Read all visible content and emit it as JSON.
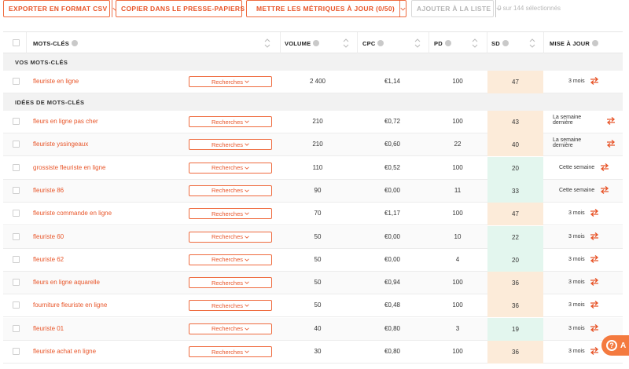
{
  "toolbar": {
    "export_label": "EXPORTER EN FORMAT CSV",
    "copy_label": "COPIER DANS LE PRESSE-PAPIERS",
    "update_label": "METTRE LES MÉTRIQUES À JOUR (0/50)",
    "add_label": "AJOUTER À LA LISTE",
    "selection_count": "0 sur 144 sélectionnés"
  },
  "columns": {
    "keywords": "MOTS-CLÉS",
    "volume": "VOLUME",
    "cpc": "CPC",
    "pd": "PD",
    "sd": "SD",
    "update": "MISE À JOUR"
  },
  "sections": {
    "yours": "VOS MOTS-CLÉS",
    "ideas": "IDÉES DE MOTS-CLÉS"
  },
  "search_label": "Recherches",
  "colors": {
    "accent": "#e8562a",
    "sd_easy": "#e3f6ee",
    "sd_medium": "#fcebd9"
  },
  "your_keywords": [
    {
      "keyword": "fleuriste en ligne",
      "volume": "2 400",
      "cpc": "€1,14",
      "pd": "100",
      "sd": "47",
      "sd_level": "medium",
      "update_line1": "3 mois",
      "update_line2": ""
    }
  ],
  "idea_keywords": [
    {
      "keyword": "fleurs en ligne pas cher",
      "volume": "210",
      "cpc": "€0,72",
      "pd": "100",
      "sd": "43",
      "sd_level": "medium",
      "update_line1": "La semaine",
      "update_line2": "dernière"
    },
    {
      "keyword": "fleuriste yssingeaux",
      "volume": "210",
      "cpc": "€0,60",
      "pd": "22",
      "sd": "40",
      "sd_level": "medium",
      "update_line1": "La semaine",
      "update_line2": "dernière"
    },
    {
      "keyword": "grossiste fleuriste en ligne",
      "volume": "110",
      "cpc": "€0,52",
      "pd": "100",
      "sd": "20",
      "sd_level": "easy",
      "update_line1": "Cette semaine",
      "update_line2": ""
    },
    {
      "keyword": "fleuriste 86",
      "volume": "90",
      "cpc": "€0,00",
      "pd": "11",
      "sd": "33",
      "sd_level": "easy",
      "update_line1": "Cette semaine",
      "update_line2": ""
    },
    {
      "keyword": "fleuriste commande en ligne",
      "volume": "70",
      "cpc": "€1,17",
      "pd": "100",
      "sd": "47",
      "sd_level": "medium",
      "update_line1": "3 mois",
      "update_line2": ""
    },
    {
      "keyword": "fleuriste 60",
      "volume": "50",
      "cpc": "€0,00",
      "pd": "10",
      "sd": "22",
      "sd_level": "easy",
      "update_line1": "3 mois",
      "update_line2": ""
    },
    {
      "keyword": "fleuriste 62",
      "volume": "50",
      "cpc": "€0,00",
      "pd": "4",
      "sd": "20",
      "sd_level": "easy",
      "update_line1": "3 mois",
      "update_line2": ""
    },
    {
      "keyword": "fleurs en ligne aquarelle",
      "volume": "50",
      "cpc": "€0,94",
      "pd": "100",
      "sd": "36",
      "sd_level": "medium",
      "update_line1": "3 mois",
      "update_line2": ""
    },
    {
      "keyword": "fourniture fleuriste en ligne",
      "volume": "50",
      "cpc": "€0,48",
      "pd": "100",
      "sd": "36",
      "sd_level": "medium",
      "update_line1": "3 mois",
      "update_line2": ""
    },
    {
      "keyword": "fleuriste 01",
      "volume": "40",
      "cpc": "€0,80",
      "pd": "3",
      "sd": "19",
      "sd_level": "easy",
      "update_line1": "3 mois",
      "update_line2": ""
    },
    {
      "keyword": "fleuriste achat en ligne",
      "volume": "30",
      "cpc": "€0,80",
      "pd": "100",
      "sd": "36",
      "sd_level": "medium",
      "update_line1": "3 mois",
      "update_line2": ""
    }
  ],
  "help": {
    "label": "A"
  }
}
